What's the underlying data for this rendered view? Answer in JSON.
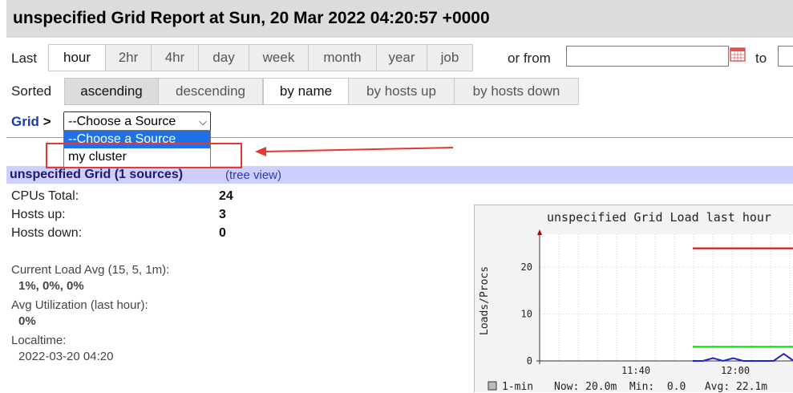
{
  "header": {
    "title": "unspecified Grid Report at Sun, 20 Mar 2022 04:20:57 +0000"
  },
  "range": {
    "label": "Last",
    "buttons": [
      "hour",
      "2hr",
      "4hr",
      "day",
      "week",
      "month",
      "year",
      "job"
    ],
    "active": "hour",
    "or_from_label": "or from",
    "to_label": "to",
    "from_value": "",
    "to_value": ""
  },
  "sort": {
    "label": "Sorted",
    "order_buttons": [
      "ascending",
      "descending"
    ],
    "by_buttons": [
      "by name",
      "by hosts up",
      "by hosts down"
    ],
    "active_order": "ascending",
    "active_by": "by name"
  },
  "nav": {
    "grid_link": "Grid",
    "separator": ">",
    "select_value": "--Choose a Source",
    "options": [
      "--Choose a Source",
      "my cluster"
    ]
  },
  "section": {
    "title": "unspecified Grid (1 sources)",
    "tree_view": "(tree view)"
  },
  "stats": [
    {
      "label": "CPUs Total:",
      "value": "24"
    },
    {
      "label": "Hosts up:",
      "value": "3"
    },
    {
      "label": "Hosts down:",
      "value": "0"
    }
  ],
  "details": {
    "load_label": "Current Load Avg (15, 5, 1m):",
    "load_value": "1%, 0%, 0%",
    "util_label": "Avg Utilization (last hour):",
    "util_value": "0%",
    "localtime_label": "Localtime:",
    "localtime_value": "2022-03-20 04:20"
  },
  "colors": {
    "annotation": "#e53935",
    "series_red": "#e00000",
    "series_green": "#00dd00",
    "series_blue": "#2222cc",
    "section_bg": "#cfcfff"
  },
  "chart_data": {
    "type": "line",
    "title": "unspecified Grid Load last hour",
    "ylabel": "Loads/Procs",
    "y_ticks": [
      "20",
      "10",
      "0"
    ],
    "x_ticks": [
      "11:40",
      "12:00"
    ],
    "ylim": [
      0,
      27
    ],
    "legend": {
      "swatch": "1-min",
      "text": "Now: 20.0m  Min:  0.0   Avg: 22.1m"
    },
    "series": [
      {
        "color": "#e00000",
        "values": [
          24,
          24
        ]
      },
      {
        "color": "#00dd00",
        "values": [
          3,
          3
        ]
      },
      {
        "color": "#2222cc",
        "values": [
          0,
          0,
          0.6,
          0,
          0.6,
          0,
          0,
          0,
          0,
          1.5,
          0
        ]
      }
    ]
  }
}
